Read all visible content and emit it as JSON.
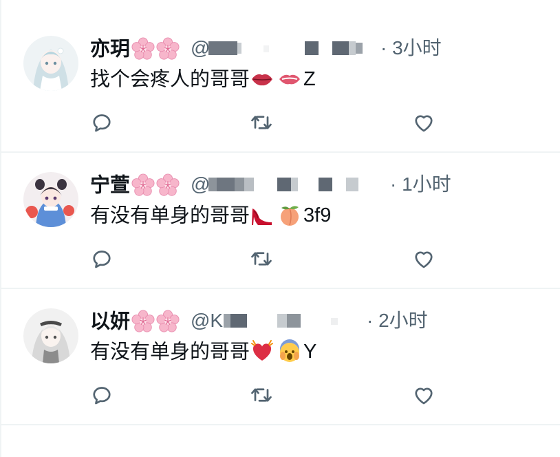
{
  "tweets": [
    {
      "name": "亦玥",
      "handle_prefix": "@",
      "time": "· 3小时",
      "text": "找个会疼人的哥哥",
      "text_suffix": "Z",
      "emojis": [
        "lips-icon",
        "kiss-lips-icon"
      ],
      "icons": {
        "reply": "reply-icon",
        "retweet": "retweet-icon",
        "like": "like-icon"
      }
    },
    {
      "name": "宁萱",
      "handle_prefix": "@",
      "time": "· 1小时",
      "text": "有没有单身的哥哥",
      "text_suffix": "3f9",
      "emojis": [
        "high-heel-icon",
        "peach-icon"
      ],
      "icons": {
        "reply": "reply-icon",
        "retweet": "retweet-icon",
        "like": "like-icon"
      }
    },
    {
      "name": "以妍",
      "handle_prefix": "@K",
      "time": "· 2小时",
      "text": "有没有单身的哥哥",
      "text_suffix": "Y",
      "emojis": [
        "beating-heart-icon",
        "screaming-face-icon"
      ],
      "icons": {
        "reply": "reply-icon",
        "retweet": "retweet-icon",
        "like": "like-icon"
      }
    }
  ],
  "colors": {
    "text": "#0f1419",
    "secondary": "#536471",
    "divider": "#eff3f4",
    "blossom": "#f4a6c0"
  }
}
